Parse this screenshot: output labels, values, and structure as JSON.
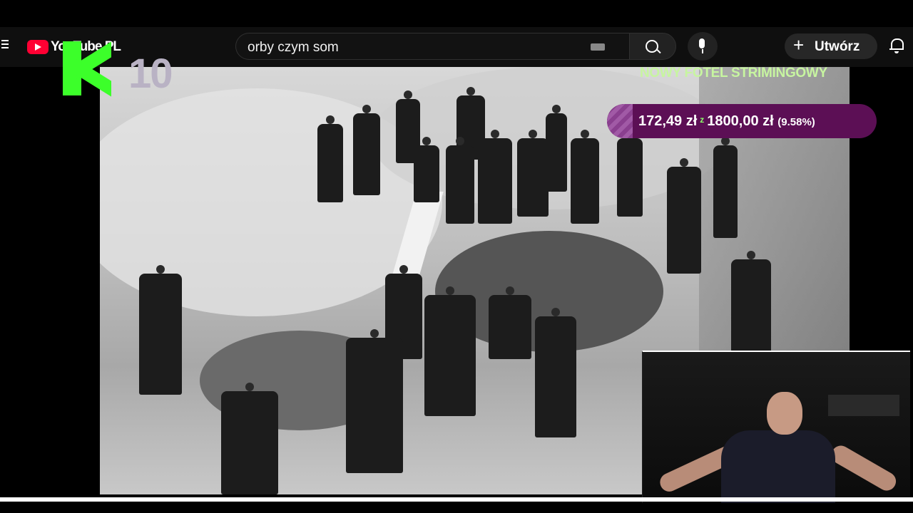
{
  "topbar": {
    "logo_text": "YouTube PL",
    "search": {
      "value": "orby czym som"
    },
    "create_label": "Utwórz",
    "create_plus": "+",
    "icons": [
      "menu-icon",
      "youtube-logo-icon",
      "keyboard-icon",
      "search-icon",
      "mic-icon",
      "plus-icon",
      "bell-icon"
    ]
  },
  "overlay": {
    "k_number": "10",
    "goal": {
      "title": "NOWY FOTEL STRIMINGOWY",
      "current": "172,49 zł",
      "separator": "z",
      "target": "1800,00 zł",
      "percent_text": "(9.58%)",
      "fraction": 0.0958
    }
  },
  "colors": {
    "accent_green": "#3cff2a",
    "goal_bar": "#5c0f55",
    "goal_fill": "#a15aa6",
    "youtube_red": "#ff0033"
  }
}
